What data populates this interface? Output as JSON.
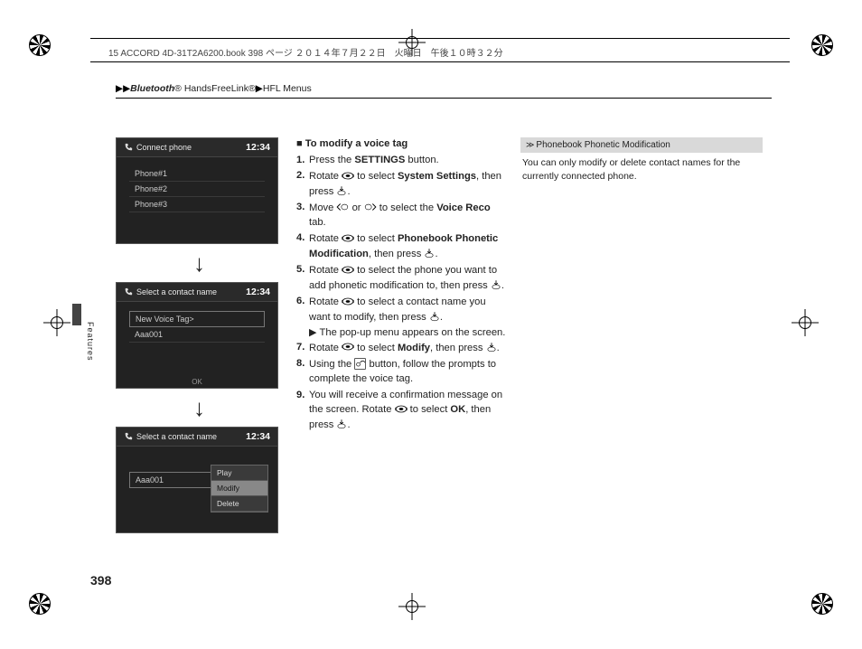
{
  "doc_header": "15 ACCORD 4D-31T2A6200.book  398 ページ  ２０１４年７月２２日　火曜日　午後１０時３２分",
  "breadcrumb": {
    "arrows": "▶▶",
    "bt_italic": "Bluetooth",
    "reg1": "®",
    "hfl": " HandsFreeLink",
    "reg2": "®",
    "sep": "▶",
    "menus": "HFL Menus"
  },
  "side_label": "Features",
  "page_number": "398",
  "screens": {
    "clock": "12:34",
    "s1": {
      "title": "Connect phone",
      "items": [
        "Phone#1",
        "Phone#2",
        "Phone#3"
      ]
    },
    "s2": {
      "title": "Select a contact name",
      "items": [
        "New Voice Tag>",
        "Aaa001"
      ],
      "ok": "OK"
    },
    "s3": {
      "title": "Select a contact name",
      "item": "Aaa001",
      "popup": [
        "Play",
        "Modify",
        "Delete"
      ],
      "selected": 1
    }
  },
  "instructions": {
    "heading_prefix": "■ ",
    "heading": "To modify a voice tag",
    "steps": [
      {
        "t": [
          "Press the ",
          {
            "b": "SETTINGS"
          },
          " button."
        ]
      },
      {
        "t": [
          "Rotate ",
          {
            "i": "dial"
          },
          " to select ",
          {
            "b": "System Settings"
          },
          ", then press ",
          {
            "i": "push"
          },
          "."
        ]
      },
      {
        "t": [
          "Move ",
          {
            "i": "left"
          },
          " or ",
          {
            "i": "right"
          },
          " to select the ",
          {
            "b": "Voice Reco"
          },
          " tab."
        ]
      },
      {
        "t": [
          "Rotate ",
          {
            "i": "dial"
          },
          " to select ",
          {
            "b": "Phonebook Phonetic Modification"
          },
          ", then press ",
          {
            "i": "push"
          },
          "."
        ]
      },
      {
        "t": [
          "Rotate ",
          {
            "i": "dial"
          },
          " to select the phone you want to add phonetic modification to, then press ",
          {
            "i": "push"
          },
          "."
        ]
      },
      {
        "t": [
          "Rotate ",
          {
            "i": "dial"
          },
          " to select a contact name you want to modify, then press ",
          {
            "i": "push"
          },
          "."
        ],
        "sub": "▶ The pop-up menu appears on the screen."
      },
      {
        "t": [
          "Rotate ",
          {
            "i": "dial"
          },
          " to select ",
          {
            "b": "Modify"
          },
          ", then press ",
          {
            "i": "push"
          },
          "."
        ]
      },
      {
        "t": [
          "Using the ",
          {
            "i": "talk"
          },
          " button, follow the prompts to complete the voice tag."
        ]
      },
      {
        "t": [
          "You will receive a confirmation message on the screen. Rotate ",
          {
            "i": "dial"
          },
          " to select ",
          {
            "b": "OK"
          },
          ", then press ",
          {
            "i": "push"
          },
          "."
        ]
      }
    ]
  },
  "tip": {
    "header_icon": "≫",
    "header": "Phonebook Phonetic Modification",
    "body": "You can only modify or delete contact names for the currently connected phone."
  }
}
